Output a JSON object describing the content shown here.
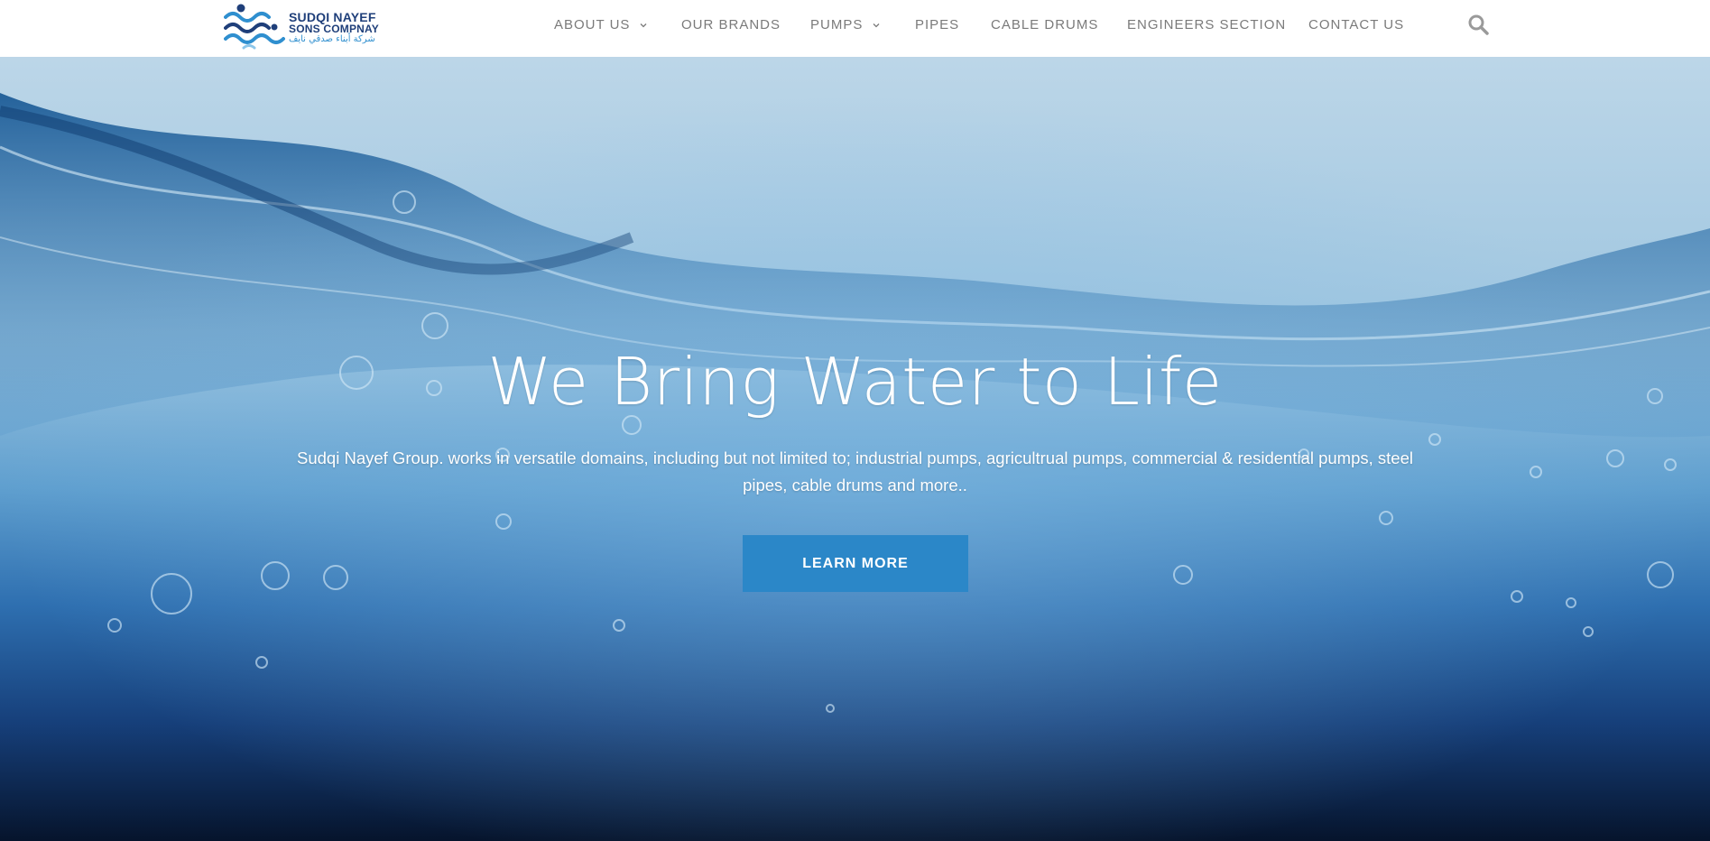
{
  "header": {
    "logo": {
      "line1": "SUDQI NAYEF",
      "line2": "SONS COMPNAY",
      "line3": "شركة أبناء صدقي نايف"
    },
    "nav": [
      {
        "label": "ABOUT US",
        "has_dropdown": true
      },
      {
        "label": "OUR BRANDS",
        "has_dropdown": false
      },
      {
        "label": "PUMPS",
        "has_dropdown": true
      },
      {
        "label": "PIPES",
        "has_dropdown": false
      },
      {
        "label": "CABLE DRUMS",
        "has_dropdown": false
      },
      {
        "label": "ENGINEERS SECTION",
        "has_dropdown": false
      },
      {
        "label": "CONTACT US",
        "has_dropdown": false
      }
    ],
    "search_icon": "search-icon"
  },
  "hero": {
    "title": "We Bring Water to Life",
    "description": "Sudqi Nayef Group. works in versatile domains, including but not limited to; industrial pumps, agricultrual pumps, commercial & residential pumps, steel pipes, cable drums and more..",
    "button_label": "LEARN MORE"
  },
  "colors": {
    "accent": "#2b87c8",
    "brand_dark": "#1f3f7a",
    "brand_light": "#2f8fcf",
    "nav_text": "#7a7a7a"
  }
}
